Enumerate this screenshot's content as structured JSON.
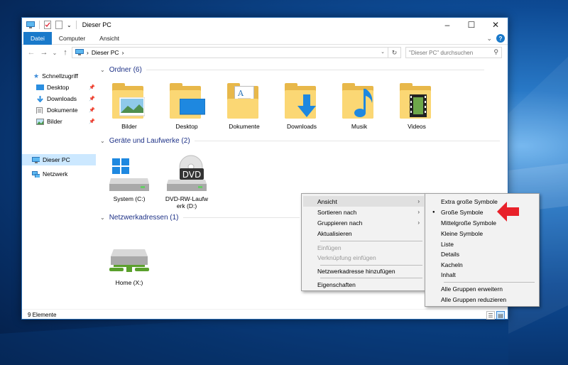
{
  "window": {
    "title": "Dieser PC",
    "controls": {
      "minimize": "–",
      "maximize": "☐",
      "close": "✕"
    }
  },
  "ribbon": {
    "tabs": [
      "Datei",
      "Computer",
      "Ansicht"
    ],
    "collapse": "⌄",
    "help": "?"
  },
  "address": {
    "back": "←",
    "forward": "→",
    "recent": "⌄",
    "up": "↑",
    "separator": "›",
    "path": "Dieser PC",
    "trail": "›",
    "dropdown": "⌄",
    "refresh": "↻",
    "search_placeholder": "\"Dieser PC\" durchsuchen",
    "search_icon": "⚲"
  },
  "sidebar": {
    "quick_access": "Schnellzugriff",
    "pinned": [
      {
        "label": "Desktop",
        "icon": "desktop-icon"
      },
      {
        "label": "Downloads",
        "icon": "downloads-icon"
      },
      {
        "label": "Dokumente",
        "icon": "documents-icon"
      },
      {
        "label": "Bilder",
        "icon": "pictures-icon"
      }
    ],
    "pin_glyph": "📌",
    "this_pc": "Dieser PC",
    "network": "Netzwerk"
  },
  "groups": {
    "folders": {
      "title": "Ordner (6)",
      "items": [
        "Bilder",
        "Desktop",
        "Dokumente",
        "Downloads",
        "Musik",
        "Videos"
      ]
    },
    "drives": {
      "title": "Geräte und Laufwerke (2)",
      "items": [
        {
          "label": "System (C:)",
          "icon": "system-drive-icon"
        },
        {
          "label": "DVD-RW-Laufwerk (D:)",
          "icon": "dvd-drive-icon",
          "badge": "DVD"
        }
      ]
    },
    "network": {
      "title": "Netzwerkadressen (1)",
      "items": [
        {
          "label": "Home (X:)",
          "icon": "network-drive-icon"
        }
      ]
    }
  },
  "status": {
    "count": "9 Elemente",
    "view_details": "☰",
    "view_tiles": "▤"
  },
  "context_menu": {
    "items": [
      {
        "label": "Ansicht",
        "submenu": true
      },
      {
        "label": "Sortieren nach",
        "submenu": true
      },
      {
        "label": "Gruppieren nach",
        "submenu": true
      },
      {
        "label": "Aktualisieren"
      },
      {
        "label": "Einfügen",
        "disabled": true
      },
      {
        "label": "Verknüpfung einfügen",
        "disabled": true
      },
      {
        "label": "Netzwerkadresse hinzufügen"
      },
      {
        "label": "Eigenschaften"
      }
    ],
    "arrow": "›"
  },
  "view_submenu": {
    "items": [
      "Extra große Symbole",
      "Große Symbole",
      "Mittelgroße Symbole",
      "Kleine Symbole",
      "Liste",
      "Details",
      "Kacheln",
      "Inhalt",
      "Alle Gruppen erweitern",
      "Alle Gruppen reduzieren"
    ],
    "selected": "Große Symbole",
    "bullet": "●"
  },
  "colors": {
    "accent": "#1979ca",
    "folder": "#fbd774",
    "arrow": "#e8212a"
  }
}
